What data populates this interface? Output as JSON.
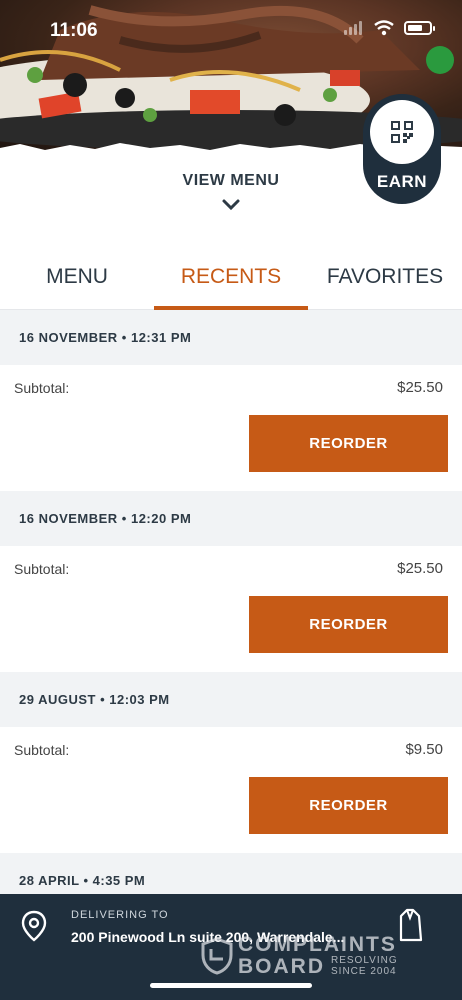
{
  "status_bar": {
    "time": "11:06"
  },
  "earn_badge": {
    "label": "EARN",
    "icon": "qr-code-icon"
  },
  "view_menu": {
    "label": "VIEW MENU",
    "icon": "chevron-down-icon"
  },
  "tabs": [
    {
      "label": "MENU",
      "active": false
    },
    {
      "label": "RECENTS",
      "active": true
    },
    {
      "label": "FAVORITES",
      "active": false
    }
  ],
  "orders": [
    {
      "date": "16 NOVEMBER • 12:31 PM",
      "subtotal_label": "Subtotal:",
      "subtotal": "$25.50",
      "button": "REORDER"
    },
    {
      "date": "16 NOVEMBER • 12:20 PM",
      "subtotal_label": "Subtotal:",
      "subtotal": "$25.50",
      "button": "REORDER"
    },
    {
      "date": "29 AUGUST • 12:03 PM",
      "subtotal_label": "Subtotal:",
      "subtotal": "$9.50",
      "button": "REORDER"
    },
    {
      "date": "28 APRIL • 4:35 PM"
    }
  ],
  "delivery": {
    "label": "DELIVERING TO",
    "address": "200 Pinewood Ln suite 200, Warrendale...",
    "location_icon": "map-pin-icon",
    "bag_icon": "shopping-bag-icon"
  },
  "watermark": {
    "line1": "COMPLAINTS",
    "line2": "BOARD",
    "tag1": "RESOLVING",
    "tag2": "SINCE 2004"
  },
  "colors": {
    "accent": "#c65a16",
    "navy": "#1f2f3d",
    "header_bg": "#f1f3f5"
  }
}
